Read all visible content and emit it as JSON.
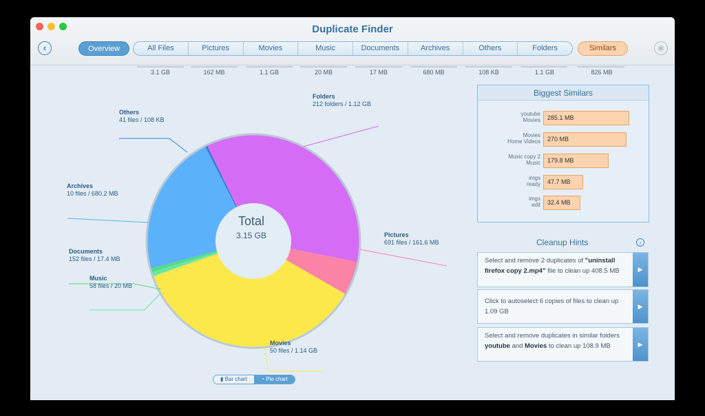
{
  "window": {
    "title": "Duplicate Finder"
  },
  "nav": {
    "overview": "Overview",
    "tabs": [
      {
        "label": "All Files",
        "size": "3.1 GB"
      },
      {
        "label": "Pictures",
        "size": "162 MB"
      },
      {
        "label": "Movies",
        "size": "1.1 GB"
      },
      {
        "label": "Music",
        "size": "20 MB"
      },
      {
        "label": "Documents",
        "size": "17 MB"
      },
      {
        "label": "Archives",
        "size": "680 MB"
      },
      {
        "label": "Others",
        "size": "108 KB"
      },
      {
        "label": "Folders",
        "size": "1.1 GB"
      }
    ],
    "similars": {
      "label": "Similars",
      "size": "826 MB"
    }
  },
  "pie": {
    "total_label": "Total",
    "total_value": "3.15 GB",
    "slices": [
      {
        "name": "Folders",
        "detail": "212 folders / 1.12 GB",
        "value": 1.12,
        "color": "#d56cf6"
      },
      {
        "name": "Pictures",
        "detail": "691 files / 161.6 MB",
        "value": 0.1616,
        "color": "#fb83a5"
      },
      {
        "name": "Movies",
        "detail": "50 files / 1.14 GB",
        "value": 1.14,
        "color": "#fde84c"
      },
      {
        "name": "Music",
        "detail": "58 files / 20 MB",
        "value": 0.02,
        "color": "#67e8a6"
      },
      {
        "name": "Documents",
        "detail": "152 files / 17.4 MB",
        "value": 0.0174,
        "color": "#56dc7e"
      },
      {
        "name": "Archives",
        "detail": "10 files / 680.2 MB",
        "value": 0.6802,
        "color": "#5bb2fb"
      },
      {
        "name": "Others",
        "detail": "41 files / 108 KB",
        "value": 0.0001,
        "color": "#3a7fd0"
      }
    ]
  },
  "similars_panel": {
    "title": "Biggest Similars",
    "items": [
      {
        "line1": "youtube",
        "line2": "Movies",
        "size": "285.1 MB",
        "mb": 285.1
      },
      {
        "line1": "Movies",
        "line2": "Home Videos",
        "size": "270 MB",
        "mb": 270
      },
      {
        "line1": "Music copy 2",
        "line2": "Music",
        "size": "179.8 MB",
        "mb": 179.8
      },
      {
        "line1": "imgs",
        "line2": "ready",
        "size": "47.7 MB",
        "mb": 47.7
      },
      {
        "line1": "imgs",
        "line2": "edit",
        "size": "32.4 MB",
        "mb": 32.4
      }
    ]
  },
  "hints": {
    "title": "Cleanup Hints",
    "items": [
      {
        "pre": "Select and remove 2 duplicates of ",
        "bold": "\"uninstall firefox copy 2.mp4\"",
        "post": " file to clean up 408.5 MB"
      },
      {
        "pre": "Click to autoselect 6 copies of files to clean up 1.09 GB",
        "bold": "",
        "post": ""
      },
      {
        "pre": "Select and remove duplicates in similar folders ",
        "bold": "youtube",
        "mid": " and ",
        "bold2": "Movies",
        "post": " to clean up 108.9 MB"
      }
    ]
  },
  "chart_toggle": {
    "bar": "Bar chart",
    "pie": "Pie chart"
  }
}
